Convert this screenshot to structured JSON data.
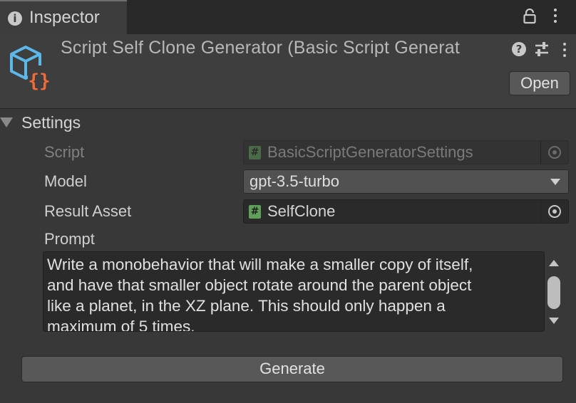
{
  "window": {
    "tab_label": "Inspector",
    "tab_icon": "info-icon",
    "lock_icon": "lock-icon",
    "menu_icon": "kebab-menu-icon"
  },
  "header": {
    "title": "Script Self Clone Generator (Basic Script Generat",
    "icon": "script-asset-icon",
    "help_icon": "help-icon",
    "presets_icon": "presets-icon",
    "menu_icon": "kebab-menu-icon",
    "open_label": "Open"
  },
  "settings": {
    "section_label": "Settings",
    "expanded": true,
    "script": {
      "label": "Script",
      "value": "BasicScriptGeneratorSettings",
      "icon": "csharp-script-icon",
      "disabled": true
    },
    "model": {
      "label": "Model",
      "value": "gpt-3.5-turbo"
    },
    "result_asset": {
      "label": "Result Asset",
      "value": "SelfClone",
      "icon": "csharp-script-icon"
    },
    "prompt": {
      "label": "Prompt",
      "value": "Write a monobehavior that will make a smaller copy of itself,\nand have that smaller object rotate around the parent object\nlike a planet, in the XZ plane. This should only happen a\nmaximum of 5 times."
    },
    "generate_label": "Generate"
  },
  "colors": {
    "background": "#383838",
    "header_background": "#3e3e3e",
    "field_background": "#2a2a2a",
    "button_background": "#585858",
    "script_icon_orange": "#f26b3a",
    "script_icon_blue": "#5bb8e8",
    "hash_icon_green": "#5fa05a"
  }
}
